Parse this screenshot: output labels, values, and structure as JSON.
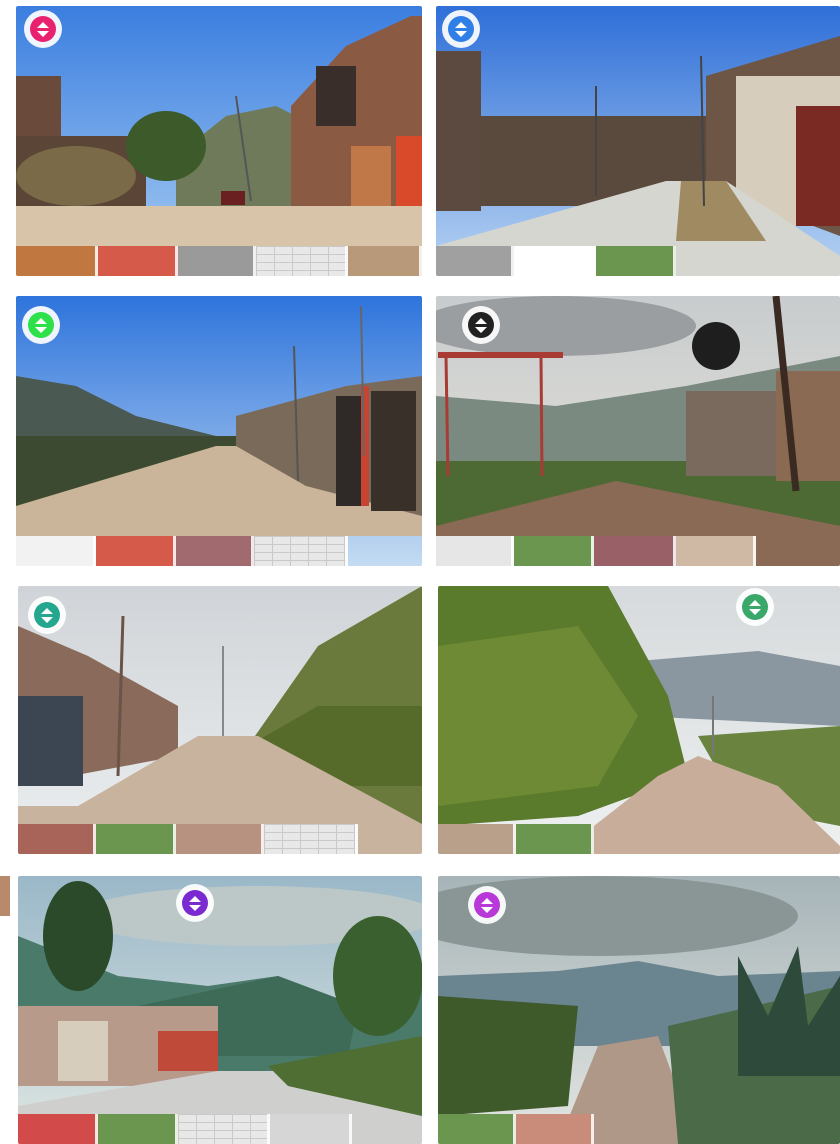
{
  "panels": [
    {
      "id": 1,
      "marker_color": "#e8226e",
      "scene": "urban-street",
      "swatches": [
        "#c07840",
        "#d65a4a",
        "#9a9a9a",
        "brick",
        "#b89a7a"
      ]
    },
    {
      "id": 2,
      "marker_color": "#2f7fe6",
      "scene": "paved-street",
      "swatches": [
        "#a0a0a0",
        "#ffffff",
        "#6a9650"
      ]
    },
    {
      "id": 3,
      "marker_color": "#2ee04a",
      "scene": "dirt-road-valley",
      "swatches": [
        "#f2f2f2",
        "#d65a4a",
        "#a06a6e",
        "brick"
      ]
    },
    {
      "id": 4,
      "marker_color": "#222222",
      "scene": "cloudy-hillside",
      "swatches": [
        "#e6e6e6",
        "#6a9650",
        "#9a6068",
        "#cfb8a4"
      ]
    },
    {
      "id": 5,
      "marker_color": "#25a68e",
      "scene": "overgrown-slope",
      "swatches": [
        "#a86458",
        "#6a9650",
        "#b89280",
        "brick"
      ]
    },
    {
      "id": 6,
      "marker_color": "#3aa86a",
      "scene": "vegetated-trail",
      "swatches": [
        "#b8a08a",
        "#6a9650"
      ]
    },
    {
      "id": 7,
      "marker_color": "#7a2ad0",
      "scene": "town-mountains",
      "swatches": [
        "#d24a4a",
        "#6a9650",
        "brick",
        "#d6d6d6"
      ]
    },
    {
      "id": 8,
      "marker_color": "#b838d8",
      "scene": "agave-trail",
      "swatches": [
        "#6a9650",
        "#c98c7a"
      ]
    }
  ],
  "edge_chips": [
    {
      "color": "#b8896a"
    }
  ]
}
